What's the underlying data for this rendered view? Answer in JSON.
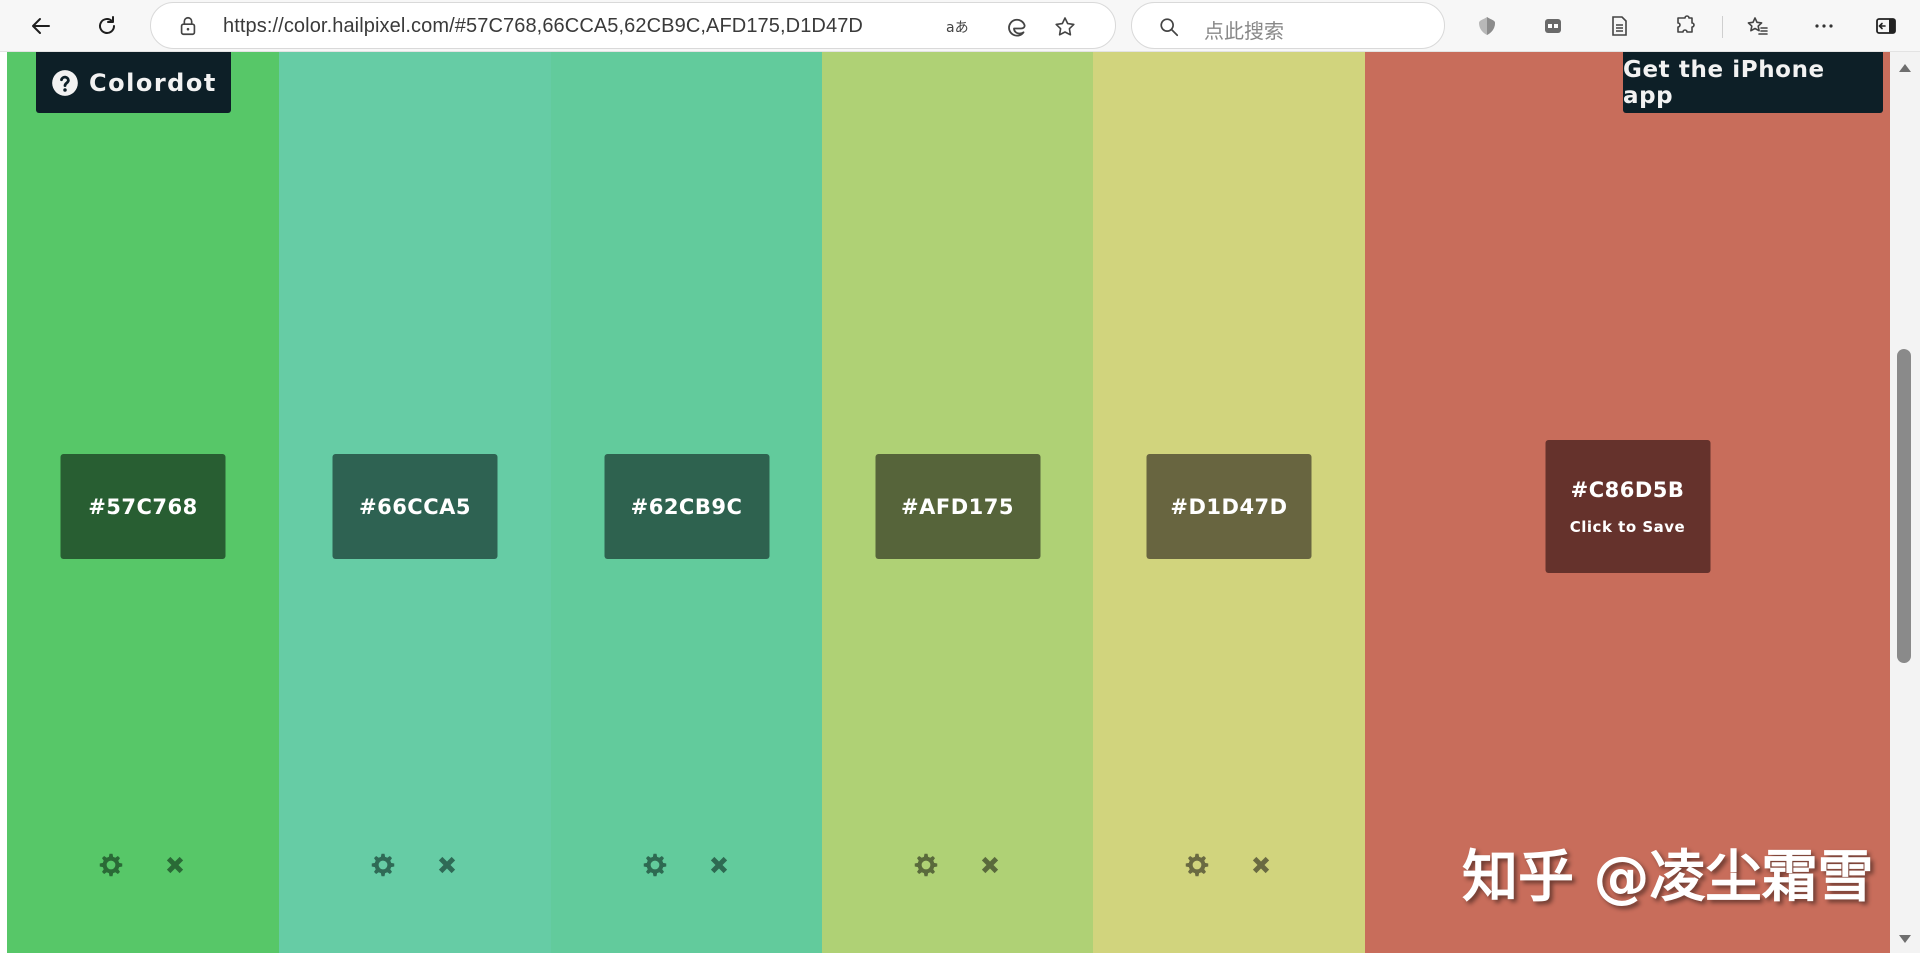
{
  "browser": {
    "url": "https://color.hailpixel.com/#57C768,66CCA5,62CB9C,AFD175,D1D47D",
    "search_placeholder": "点此搜索"
  },
  "page": {
    "app_name": "Colordot",
    "iphone_app_label": "Get the iPhone app",
    "watermark": "知乎 @凌尘霜雪",
    "colors": [
      {
        "hex": "#57C768",
        "bg": "#57C768",
        "swatch_bg": "#285E32",
        "icon_color": "#2A6A36"
      },
      {
        "hex": "#66CCA5",
        "bg": "#66CCA5",
        "swatch_bg": "#2E6252",
        "icon_color": "#2F6A56"
      },
      {
        "hex": "#62CB9C",
        "bg": "#62CB9C",
        "swatch_bg": "#2E624F",
        "icon_color": "#2E6A52"
      },
      {
        "hex": "#AFD175",
        "bg": "#AFD175",
        "swatch_bg": "#56643A",
        "icon_color": "#5A6A3C"
      },
      {
        "hex": "#D1D47D",
        "bg": "#D1D47D",
        "swatch_bg": "#686540",
        "icon_color": "#6A6A42"
      }
    ],
    "current": {
      "hex": "#C86D5B",
      "bg": "#C86D5B",
      "swatch_bg": "#65322C",
      "save_label": "Click to Save"
    }
  }
}
